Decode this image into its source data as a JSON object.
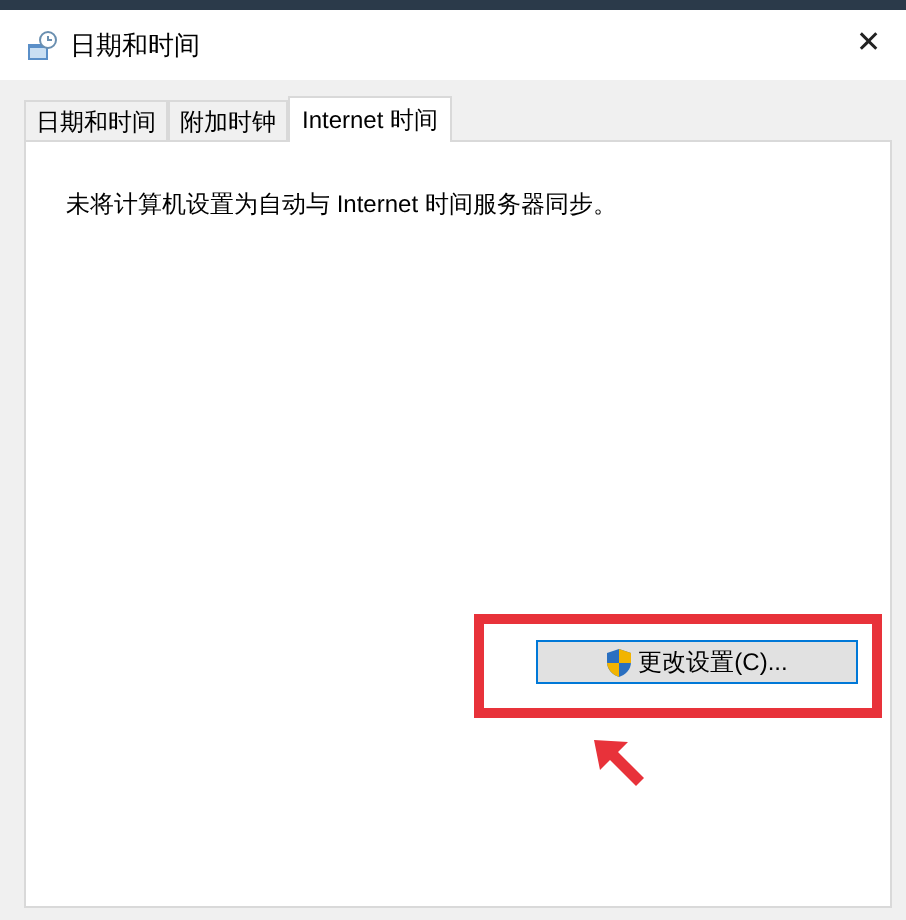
{
  "window": {
    "title": "日期和时间",
    "close": "✕"
  },
  "tabs": [
    {
      "label": "日期和时间",
      "selected": false
    },
    {
      "label": "附加时钟",
      "selected": false
    },
    {
      "label": "Internet 时间",
      "selected": true
    }
  ],
  "message": "未将计算机设置为自动与 Internet 时间服务器同步。",
  "change_button": {
    "label": "更改设置(C)...",
    "highlighted": true
  }
}
